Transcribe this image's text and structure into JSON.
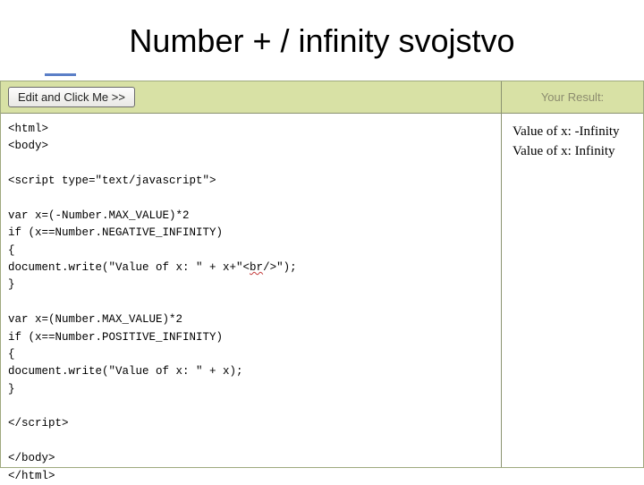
{
  "title": "Number + / infinity svojstvo",
  "header": {
    "button_label": "Edit and Click Me >>",
    "result_label": "Your Result:"
  },
  "code": {
    "l1": "<html>",
    "l2": "<body>",
    "l3": "",
    "l4": "<script type=\"text/javascript\">",
    "l5": "",
    "l6": "var x=(-Number.MAX_VALUE)*2",
    "l7": "if (x==Number.NEGATIVE_INFINITY)",
    "l8": "{",
    "l9a": "document.write(\"Value of x: \" + x+\"<",
    "l9b": "br",
    "l9c": "/>\");",
    "l10": "}",
    "l11": "",
    "l12": "var x=(Number.MAX_VALUE)*2",
    "l13": "if (x==Number.POSITIVE_INFINITY)",
    "l14": "{",
    "l15": "document.write(\"Value of x: \" + x);",
    "l16": "}",
    "l17": "",
    "l18": "</script>",
    "l19": "",
    "l20": "</body>",
    "l21": "</html>"
  },
  "result": {
    "line1": "Value of x: -Infinity",
    "line2": "Value of x: Infinity"
  }
}
